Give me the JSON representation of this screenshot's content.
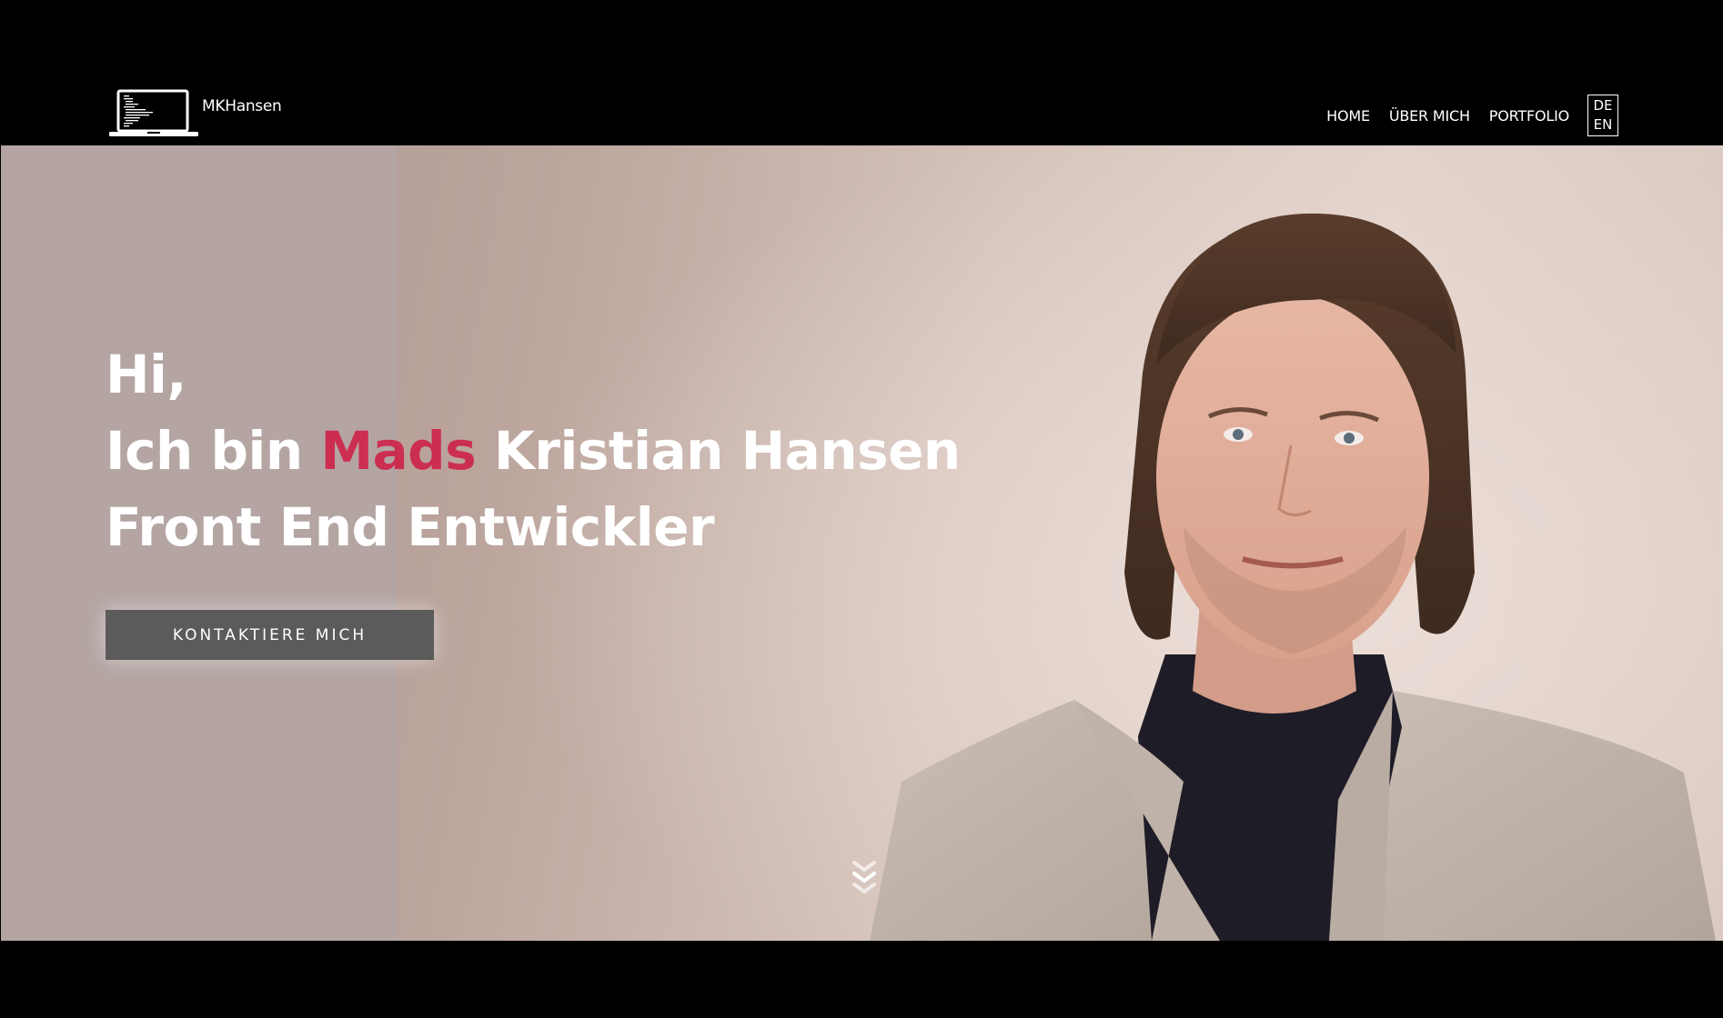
{
  "brand": {
    "logo_text": "MKHansen",
    "logo_icon": "laptop-code-icon"
  },
  "nav": {
    "items": [
      {
        "label": "HOME"
      },
      {
        "label": "ÜBER MICH"
      },
      {
        "label": "PORTFOLIO"
      }
    ],
    "languages": [
      "DE",
      "EN"
    ]
  },
  "hero": {
    "greeting": "Hi,",
    "intro_prefix": "Ich bin ",
    "intro_highlight": "Mads",
    "intro_suffix": " Kristian Hansen",
    "role": "Front End Entwickler",
    "cta_label": "KONTAKTIERE MICH",
    "scroll_icon": "double-chevron-down-icon"
  },
  "colors": {
    "background": "#000000",
    "accent": "#cc2e52",
    "button": "#5b5b5b",
    "panel": "#b4a5a3"
  }
}
